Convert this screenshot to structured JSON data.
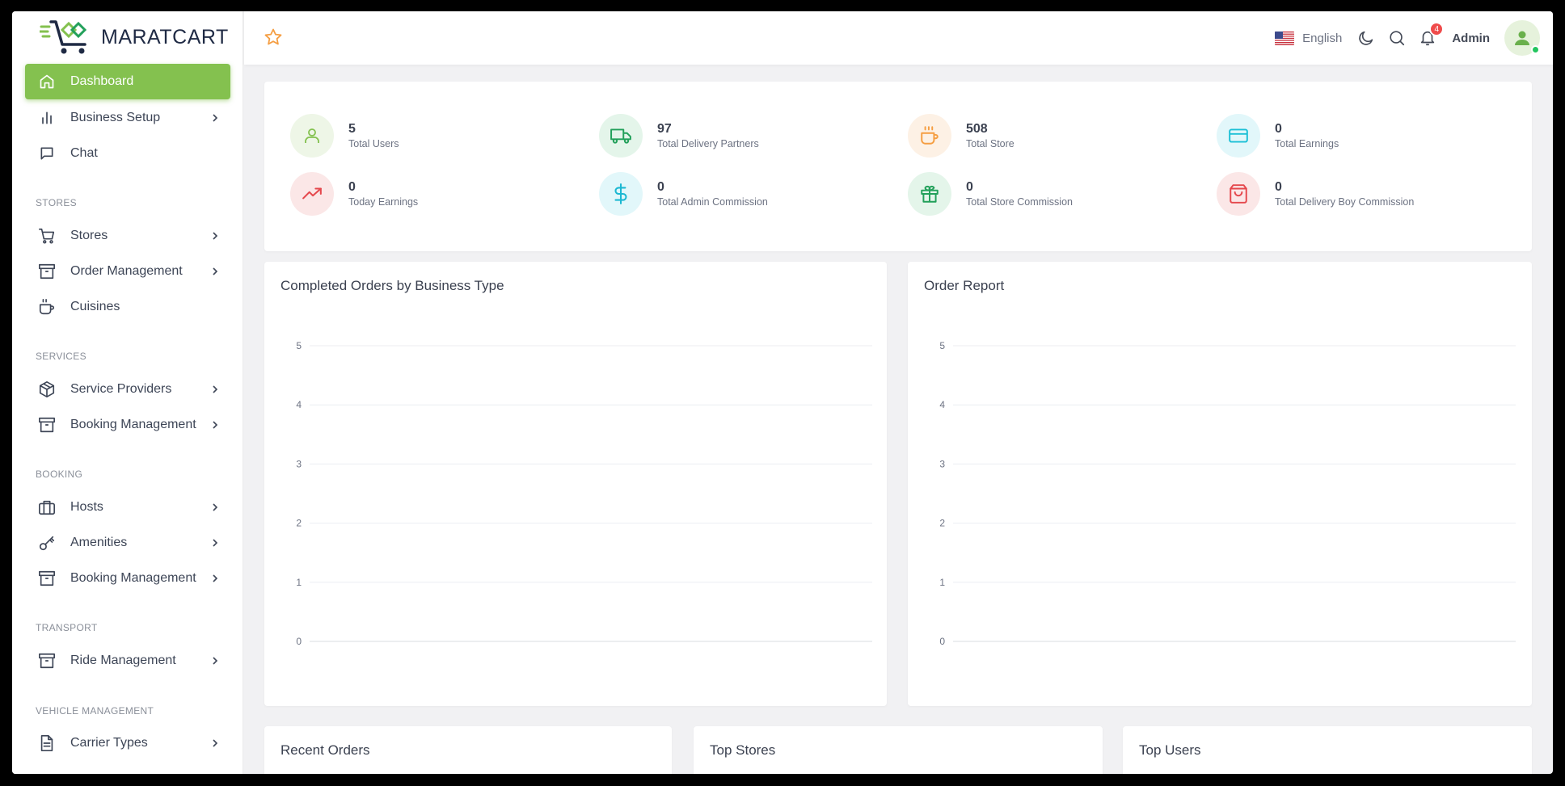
{
  "brand": {
    "name": "MARATCART"
  },
  "sidebar": {
    "items": [
      {
        "key": "dashboard",
        "label": "Dashboard"
      },
      {
        "key": "business-setup",
        "label": "Business Setup"
      },
      {
        "key": "chat",
        "label": "Chat"
      },
      {
        "key": "stores",
        "label": "Stores"
      },
      {
        "key": "order-management",
        "label": "Order Management"
      },
      {
        "key": "cuisines",
        "label": "Cuisines"
      },
      {
        "key": "service-providers",
        "label": "Service Providers"
      },
      {
        "key": "booking-management-services",
        "label": "Booking Management"
      },
      {
        "key": "hosts",
        "label": "Hosts"
      },
      {
        "key": "amenities",
        "label": "Amenities"
      },
      {
        "key": "booking-management-booking",
        "label": "Booking Management"
      },
      {
        "key": "ride-management",
        "label": "Ride Management"
      },
      {
        "key": "carrier-types",
        "label": "Carrier Types"
      }
    ],
    "sections": {
      "stores": "STORES",
      "services": "SERVICES",
      "booking": "BOOKING",
      "transport": "TRANSPORT",
      "vehicle": "VEHICLE MANAGEMENT"
    }
  },
  "header": {
    "language": "English",
    "notifications_count": "4",
    "user_name": "Admin"
  },
  "stats": [
    {
      "value": "5",
      "label": "Total Users",
      "icon": "user-icon",
      "color": "#84c14f",
      "bg": "#eef6e7"
    },
    {
      "value": "97",
      "label": "Total Delivery Partners",
      "icon": "truck-icon",
      "color": "#22a05a",
      "bg": "#e4f5ea"
    },
    {
      "value": "508",
      "label": "Total Store",
      "icon": "coffee-icon",
      "color": "#f59e42",
      "bg": "#fdf1e5"
    },
    {
      "value": "0",
      "label": "Total Earnings",
      "icon": "credit-card-icon",
      "color": "#1cc0d6",
      "bg": "#e2f7fa"
    },
    {
      "value": "0",
      "label": "Today Earnings",
      "icon": "trending-up-icon",
      "color": "#e5484d",
      "bg": "#fbe7e7"
    },
    {
      "value": "0",
      "label": "Total Admin Commission",
      "icon": "dollar-icon",
      "color": "#1cb8d2",
      "bg": "#e2f7fa"
    },
    {
      "value": "0",
      "label": "Total Store Commission",
      "icon": "gift-icon",
      "color": "#22a05a",
      "bg": "#e4f5ea"
    },
    {
      "value": "0",
      "label": "Total Delivery Boy Commission",
      "icon": "shopping-bag-icon",
      "color": "#e5484d",
      "bg": "#fbe7e7"
    }
  ],
  "chart_data": [
    {
      "type": "bar",
      "title": "Completed Orders by Business Type",
      "categories": [],
      "values": [],
      "ylim": [
        0,
        5
      ],
      "yticks": [
        0,
        1,
        2,
        3,
        4,
        5
      ],
      "grid": true
    },
    {
      "type": "line",
      "title": "Order Report",
      "categories": [],
      "values": [],
      "ylim": [
        0,
        5
      ],
      "yticks": [
        0,
        1,
        2,
        3,
        4,
        5
      ],
      "grid": true
    }
  ],
  "panels": {
    "recent_orders": "Recent Orders",
    "top_stores": "Top Stores",
    "top_users": "Top Users"
  }
}
